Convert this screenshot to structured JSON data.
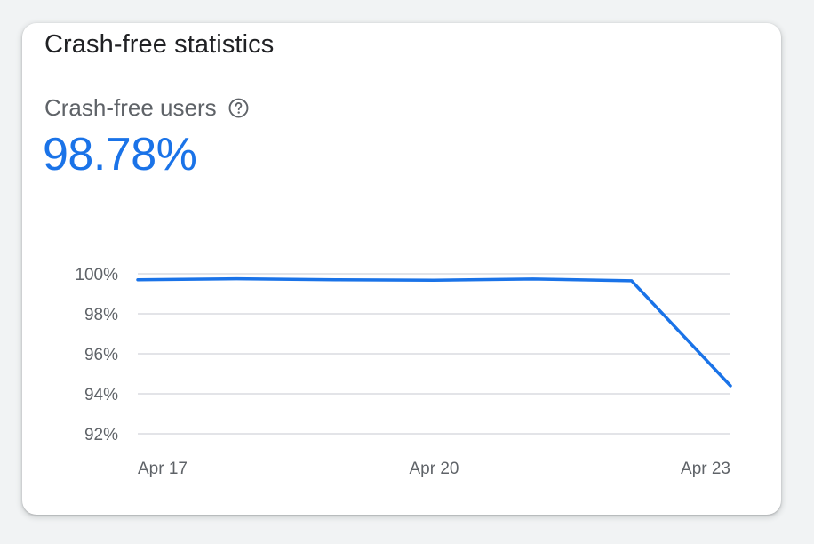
{
  "card": {
    "title": "Crash-free statistics",
    "metric_label": "Crash-free users",
    "metric_value": "98.78%",
    "help_icon": "help-circle-icon"
  },
  "colors": {
    "accent": "#1a73e8",
    "grid": "#dadce0",
    "text_secondary": "#5f6368"
  },
  "chart_data": {
    "type": "line",
    "x": [
      "Apr 17",
      "Apr 18",
      "Apr 19",
      "Apr 20",
      "Apr 21",
      "Apr 22",
      "Apr 23"
    ],
    "x_tick_labels": [
      "Apr 17",
      "Apr 20",
      "Apr 23"
    ],
    "y_tick_labels": [
      "100%",
      "98%",
      "96%",
      "94%",
      "92%"
    ],
    "y_ticks": [
      100,
      98,
      96,
      94,
      92
    ],
    "ylim": [
      92,
      100
    ],
    "series": [
      {
        "values": [
          99.7,
          99.75,
          99.7,
          99.68,
          99.74,
          99.65,
          94.4
        ]
      }
    ],
    "grid": true,
    "title": "",
    "xlabel": "",
    "ylabel": ""
  }
}
